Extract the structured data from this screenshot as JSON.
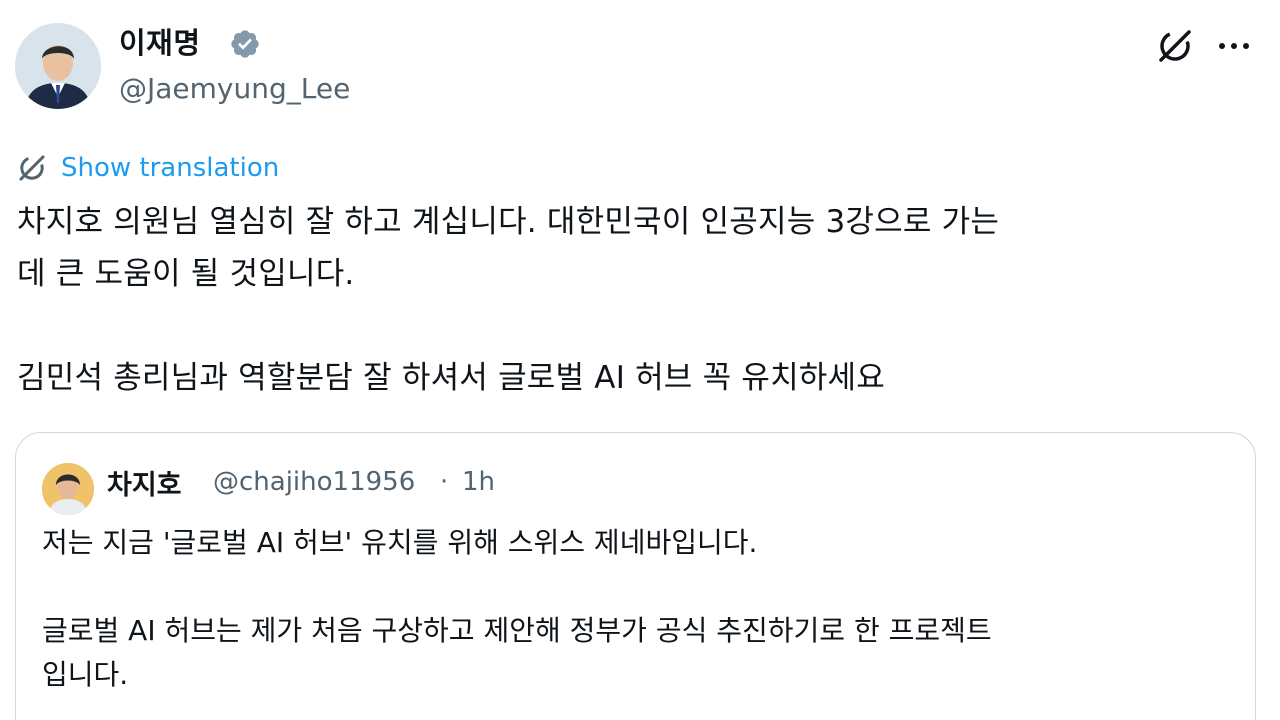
{
  "author": {
    "display_name": "이재명",
    "handle": "@Jaemyung_Lee"
  },
  "actions": {
    "grok_icon": "grok-icon",
    "more_icon": "more-horizontal-icon"
  },
  "translation": {
    "label": "Show translation"
  },
  "tweet": {
    "text": "차지호 의원님 열심히 잘 하고 계십니다. 대한민국이 인공지능 3강으로 가는\n데 큰 도움이 될 것입니다.\n\n김민석 총리님과 역할분담 잘 하셔서 글로벌 AI 허브 꼭 유치하세요"
  },
  "quote": {
    "display_name": "차지호",
    "handle": "@chajiho11956",
    "separator": "·",
    "time": "1h",
    "text": "저는 지금 '글로벌 AI 허브' 유치를 위해 스위스 제네바입니다.\n\n글로벌 AI 허브는 제가 처음 구상하고 제안해 정부가 공식 추진하기로 한 프로젝트\n입니다."
  },
  "colors": {
    "accent": "#1d9bf0",
    "secondary_text": "#536471",
    "border": "#cfd9de",
    "verified_badge": "#829aab"
  }
}
